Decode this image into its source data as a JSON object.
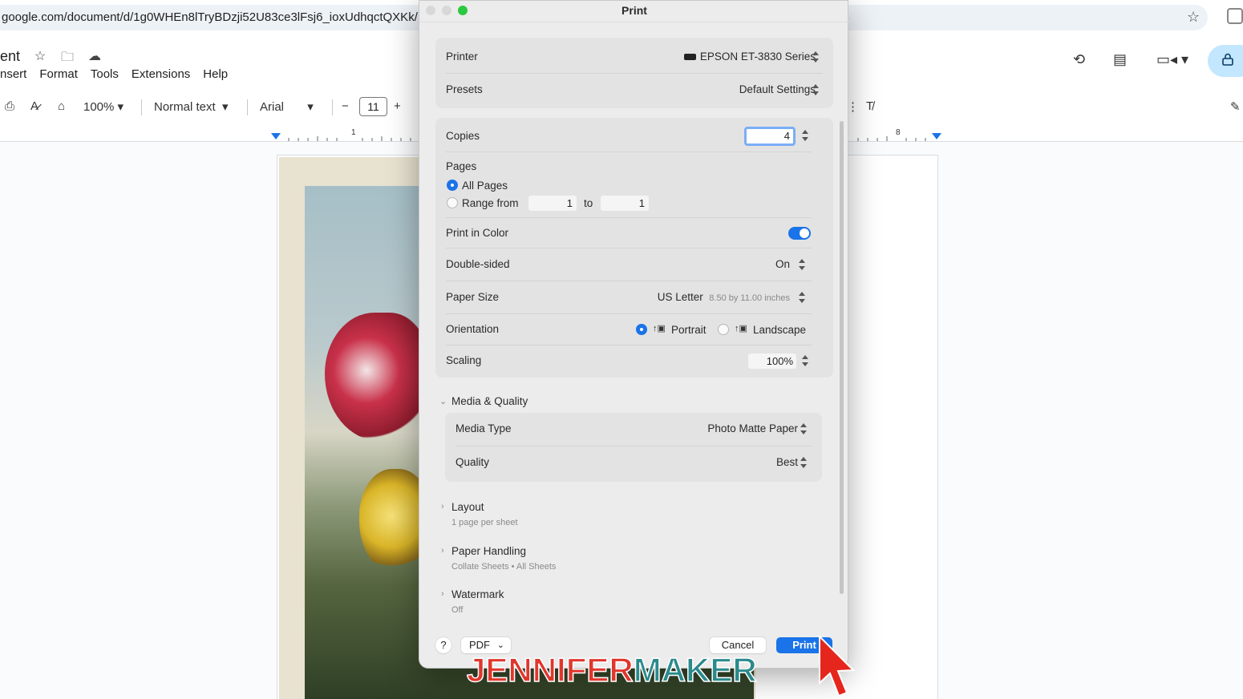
{
  "browser": {
    "url": "google.com/document/d/1g0WHEn8lTryBDzji52U83ce3lFsj6_ioxUdhqctQXKk/"
  },
  "docs": {
    "title_fragment": "ent",
    "menu": [
      "nsert",
      "Format",
      "Tools",
      "Extensions",
      "Help"
    ],
    "toolbar": {
      "zoom": "100%",
      "style": "Normal text",
      "font": "Arial",
      "font_size": "11",
      "minus": "−",
      "plus": "+"
    },
    "ruler": {
      "left_num": "1",
      "right_num": "8"
    }
  },
  "print_dialog": {
    "title": "Print",
    "printer": {
      "label": "Printer",
      "value": "EPSON ET-3830 Series"
    },
    "presets": {
      "label": "Presets",
      "value": "Default Settings"
    },
    "copies": {
      "label": "Copies",
      "value": "4"
    },
    "pages": {
      "label": "Pages",
      "all_pages": "All Pages",
      "range_from": "Range from",
      "from_value": "1",
      "to_label": "to",
      "to_value": "1",
      "selected": "all"
    },
    "print_in_color": {
      "label": "Print in Color",
      "on": true
    },
    "double_sided": {
      "label": "Double-sided",
      "value": "On"
    },
    "paper_size": {
      "label": "Paper Size",
      "value": "US Letter",
      "detail": "8.50 by 11.00 inches"
    },
    "orientation": {
      "label": "Orientation",
      "portrait": "Portrait",
      "landscape": "Landscape",
      "selected": "portrait"
    },
    "scaling": {
      "label": "Scaling",
      "value": "100%"
    },
    "media_quality": {
      "header": "Media & Quality",
      "media_type": {
        "label": "Media Type",
        "value": "Photo Matte Paper"
      },
      "quality": {
        "label": "Quality",
        "value": "Best"
      }
    },
    "layout": {
      "header": "Layout",
      "sub": "1 page per sheet"
    },
    "paper_handling": {
      "header": "Paper Handling",
      "sub": "Collate Sheets • All Sheets"
    },
    "watermark": {
      "header": "Watermark",
      "sub": "Off"
    },
    "footer": {
      "help": "?",
      "pdf": "PDF",
      "cancel": "Cancel",
      "print": "Print"
    }
  },
  "watermark_logo": {
    "part1": "JENNIFER",
    "part2": "MAKER"
  },
  "colors": {
    "accent": "#1a73e8",
    "logo_red": "#e0362c",
    "logo_teal": "#2a8a8c"
  }
}
